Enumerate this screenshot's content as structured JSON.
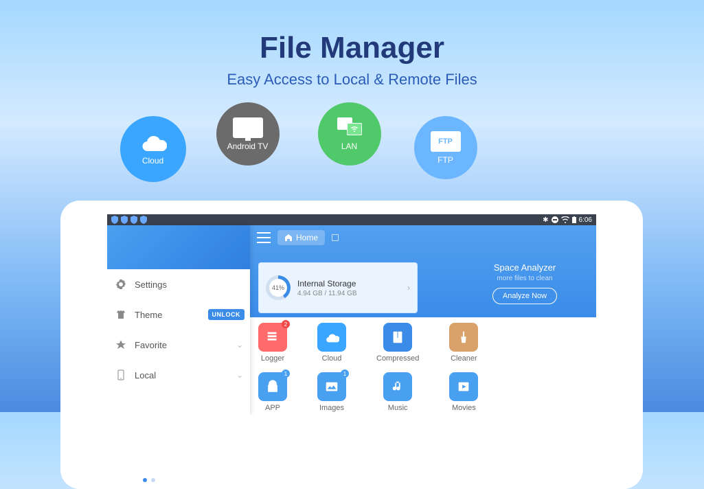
{
  "header": {
    "title": "File Manager",
    "subtitle": "Easy Access to Local & Remote Files"
  },
  "bubbles": {
    "cloud": "Cloud",
    "androidtv": "Android TV",
    "lan": "LAN",
    "ftp": "FTP"
  },
  "status": {
    "time": "6:06"
  },
  "appbar": {
    "home_label": "Home"
  },
  "storage": {
    "percent_label": "41%",
    "title": "Internal Storage",
    "sub": "4.94 GB / 11.94 GB"
  },
  "analyzer": {
    "title": "Space Analyzer",
    "sub": "more files to clean",
    "button": "Analyze Now"
  },
  "sidebar": {
    "items": [
      {
        "label": "Settings"
      },
      {
        "label": "Theme",
        "badge": "UNLOCK"
      },
      {
        "label": "Favorite"
      },
      {
        "label": "Local"
      }
    ]
  },
  "grid": {
    "cols": [
      [
        {
          "label": "Logger",
          "badge": "2",
          "badgeColor": "red"
        },
        {
          "label": "APP",
          "badge": "1",
          "badgeColor": "blue"
        }
      ],
      [
        {
          "label": "Cloud"
        },
        {
          "label": "Images",
          "badge": "1",
          "badgeColor": "blue"
        }
      ],
      [
        {
          "label": "Compressed"
        },
        {
          "label": "Music"
        }
      ],
      [
        {
          "label": "Cleaner"
        },
        {
          "label": "Movies"
        }
      ]
    ]
  }
}
